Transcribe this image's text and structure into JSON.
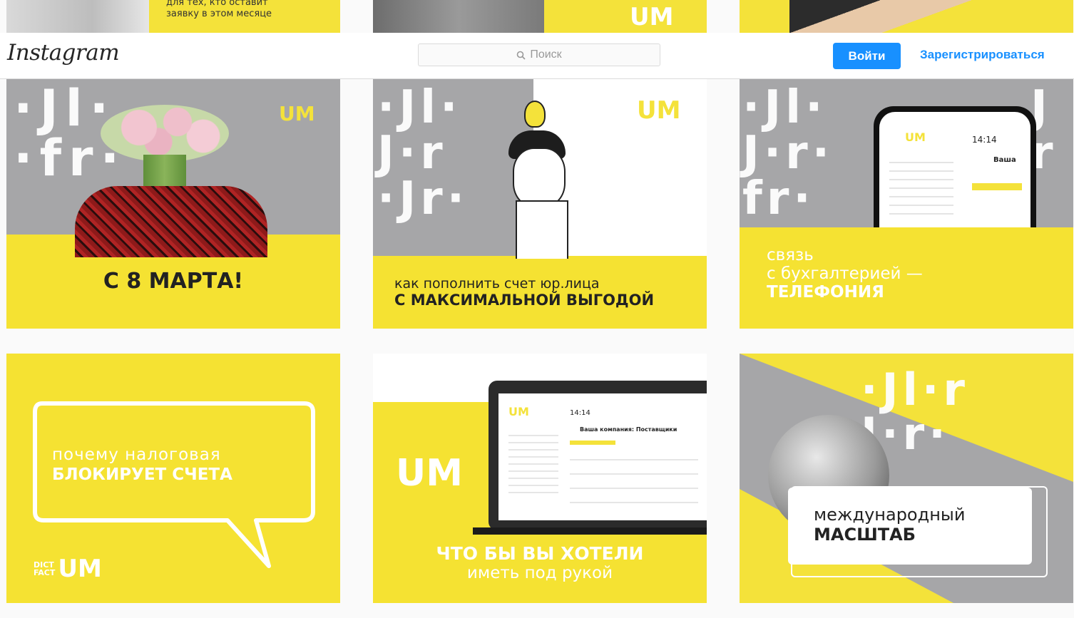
{
  "header": {
    "logo": "Instagram",
    "search_placeholder": "Поиск",
    "login_label": "Войти",
    "register_label": "Зарегистрироваться"
  },
  "top_row": {
    "tile1_text_line1": "для тех, кто оставит",
    "tile1_text_line2": "заявку в этом месяце",
    "tile2_logo": "UM"
  },
  "posts": [
    {
      "title": "С 8 МАРТА!",
      "logo": "UM"
    },
    {
      "line1": "как пополнить счет юр.лица",
      "line2": "С МАКСИМАЛЬНОЙ ВЫГОДОЙ",
      "logo": "UM"
    },
    {
      "line1": "связь",
      "line2": "с бухгалтерией —",
      "line3": "ТЕЛЕФОНИЯ",
      "phone_time": "14:14",
      "phone_company": "Ваша"
    },
    {
      "line1": "почему налоговая",
      "line2": "БЛОКИРУЕТ СЧЕТА",
      "brand_top": "DICT",
      "brand_bottom": "FACT",
      "logo": "UM"
    },
    {
      "line1": "ЧТО БЫ ВЫ ХОТЕЛИ",
      "line2": "иметь под рукой",
      "logo": "UM",
      "screen_time": "14:14",
      "screen_title": "Ваша компания: Поставщики"
    },
    {
      "line1": "международный",
      "line2": "МАСШТАБ"
    }
  ],
  "colors": {
    "brand_yellow": "#f4e23a",
    "accent_blue": "#1890ff",
    "pattern_gray": "#a6a6a8"
  }
}
